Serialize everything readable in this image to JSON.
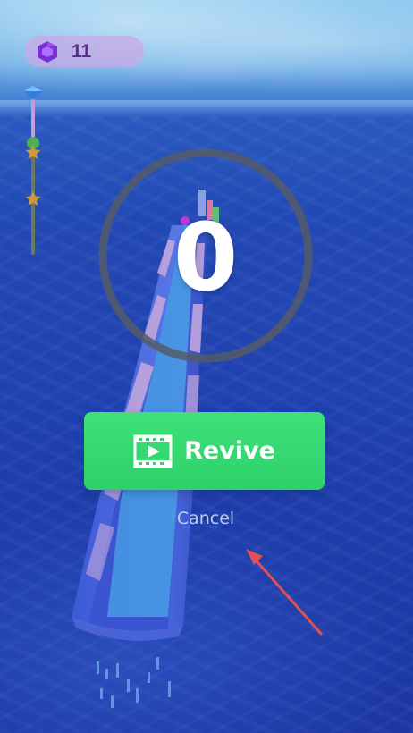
{
  "hud": {
    "gem_icon": "purple-gem-icon",
    "gem_count": "11"
  },
  "level_progress": {
    "top_icon": "blue-diamond-icon",
    "markers": [
      "green-dot-marker",
      "star-marker",
      "star-marker"
    ],
    "colors": {
      "track": "#6a7a5a",
      "star": "#c99a3c",
      "dot": "#4caf50"
    }
  },
  "revive": {
    "countdown": "0",
    "timer_fill_fraction": 0.14,
    "button_label": "Revive",
    "button_icon": "film-play-icon",
    "cancel_label": "Cancel"
  },
  "colors": {
    "button": "#33d46e",
    "ring_track": "#555a6a",
    "ring_fill": "#d8f5d0",
    "annotation_arrow": "#e05050"
  }
}
